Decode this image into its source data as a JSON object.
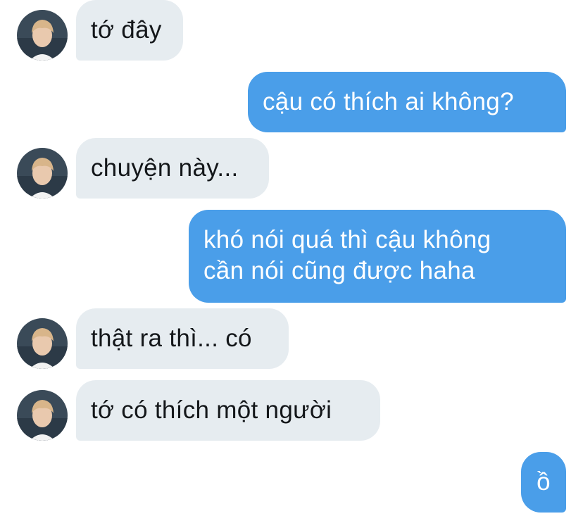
{
  "messages": [
    {
      "side": "incoming",
      "text": "tớ đây"
    },
    {
      "side": "outgoing",
      "lines": [
        "cậu có thích ai không?"
      ]
    },
    {
      "side": "incoming",
      "text": "chuyện này..."
    },
    {
      "side": "outgoing",
      "lines": [
        "khó nói quá thì cậu không",
        "cần nói cũng được haha"
      ]
    },
    {
      "side": "incoming",
      "text": "thật ra thì... có"
    },
    {
      "side": "incoming",
      "text": "tớ có thích một người"
    },
    {
      "side": "outgoing",
      "lines": [
        "ồ"
      ]
    }
  ],
  "colors": {
    "incoming_bubble": "#e6ecf0",
    "incoming_text": "#14171a",
    "outgoing_bubble": "#4a9ee9",
    "outgoing_text": "#ffffff"
  },
  "icons": {
    "avatar": "profile-photo"
  }
}
